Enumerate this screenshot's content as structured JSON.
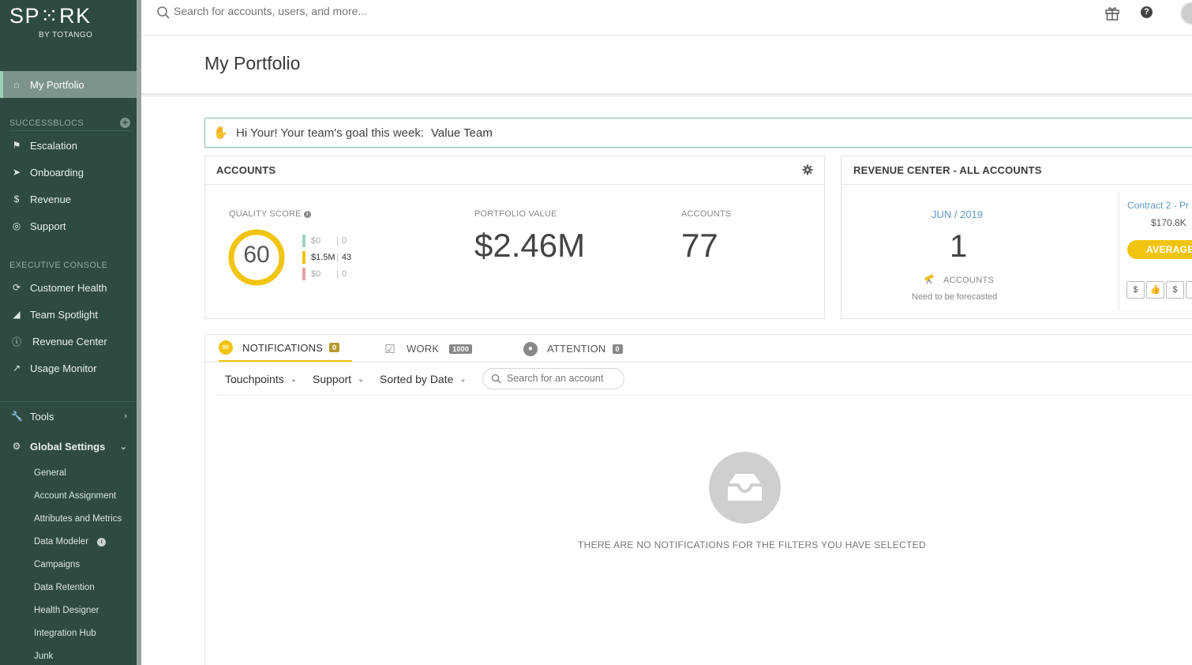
{
  "logo": {
    "main": "SP⁙RK",
    "sub": "BY TOTANGO"
  },
  "sidebar": {
    "active_item": {
      "label": "My Portfolio",
      "icon": "home-icon"
    },
    "successblocs": {
      "label": "SUCCESSBLOCS",
      "items": [
        {
          "label": "Escalation",
          "icon": "flag-icon"
        },
        {
          "label": "Onboarding",
          "icon": "rocket-icon"
        },
        {
          "label": "Revenue",
          "icon": "dollar-icon"
        },
        {
          "label": "Support",
          "icon": "lifebuoy-icon"
        }
      ]
    },
    "executive_console": {
      "label": "EXECUTIVE CONSOLE",
      "items": [
        {
          "label": "Customer Health",
          "icon": "refresh-icon"
        },
        {
          "label": "Team Spotlight",
          "icon": "spotlight-icon"
        },
        {
          "label": "Revenue Center",
          "icon": "dollar-circle-icon"
        },
        {
          "label": "Usage Monitor",
          "icon": "chart-line-icon"
        }
      ]
    },
    "tools": {
      "label": "Tools",
      "icon": "wrench-icon"
    },
    "global_settings": {
      "label": "Global Settings",
      "icon": "gear-icon",
      "items": [
        "General",
        "Account Assignment",
        "Attributes and Metrics",
        "Data Modeler",
        "Campaigns",
        "Data Retention",
        "Health Designer",
        "Integration Hub",
        "Junk"
      ]
    }
  },
  "search": {
    "placeholder": "Search for accounts, users, and more..."
  },
  "page": {
    "title": "My Portfolio"
  },
  "goal": {
    "text": "Hi Your! Your team's goal this week:",
    "value": "Value Team"
  },
  "accounts_card": {
    "title": "ACCOUNTS",
    "quality_score": {
      "label": "QUALITY SCORE",
      "value": "60",
      "segments": [
        {
          "amount": "$0",
          "count": "0",
          "color": "#9fd3bb"
        },
        {
          "amount": "$1.5M",
          "count": "43",
          "color": "#f1c40f"
        },
        {
          "amount": "$0",
          "count": "0",
          "color": "#e6a1a1"
        }
      ]
    },
    "portfolio_value": {
      "label": "PORTFOLIO VALUE",
      "value": "$2.46M"
    },
    "accounts": {
      "label": "ACCOUNTS",
      "value": "77"
    }
  },
  "revenue_card": {
    "title": "REVENUE CENTER - ALL ACCOUNTS",
    "month": "JUN / 2019",
    "count": "1",
    "accounts_label": "ACCOUNTS",
    "note": "Need to be forecasted",
    "contract": {
      "name": "Contract 2 - Pr",
      "value": "$170.8K",
      "badge": "AVERAGE"
    }
  },
  "tabs": [
    {
      "label": "NOTIFICATIONS",
      "count": "0",
      "active": true
    },
    {
      "label": "WORK",
      "count": "1000",
      "active": false
    },
    {
      "label": "ATTENTION",
      "count": "0",
      "active": false
    }
  ],
  "filters": {
    "touchpoints": "Touchpoints",
    "support": "Support",
    "sort": "Sorted by Date",
    "search_placeholder": "Search for an account"
  },
  "empty_state": {
    "text": "THERE ARE NO NOTIFICATIONS FOR THE FILTERS YOU HAVE SELECTED"
  },
  "colors": {
    "sidebar": "#2e4a43",
    "accent_yellow": "#f1c40f",
    "link_blue": "#5e97c4",
    "banner_border": "#7fbf9b"
  }
}
